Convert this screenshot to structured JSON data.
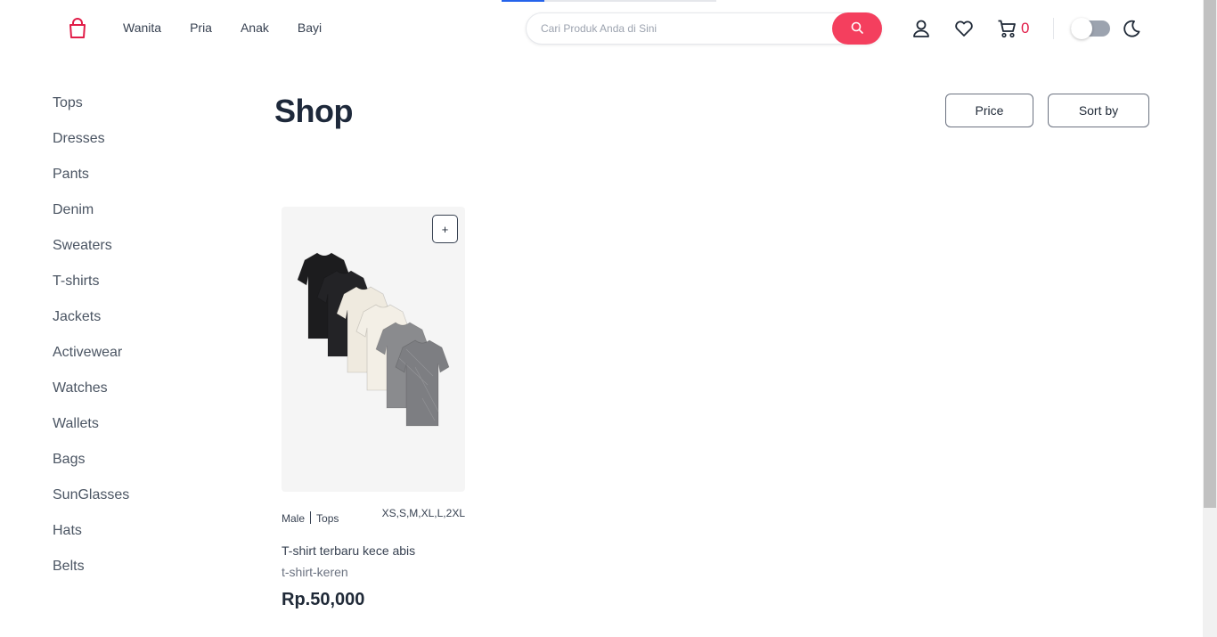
{
  "page_progress": 0.2,
  "colors": {
    "accent": "#f43f5e",
    "cart_count": "#e11d48",
    "title": "#1e293b"
  },
  "header": {
    "logo_icon": "shopping-bag-icon",
    "nav": [
      "Wanita",
      "Pria",
      "Anak",
      "Bayi"
    ],
    "search": {
      "placeholder": "Cari Produk Anda di Sini",
      "value": "",
      "icon": "search-icon"
    },
    "icons": [
      "user-icon",
      "heart-icon",
      "cart-icon"
    ],
    "cart_count": "0",
    "theme_icon": "moon-icon"
  },
  "sidebar": {
    "categories": [
      "Tops",
      "Dresses",
      "Pants",
      "Denim",
      "Sweaters",
      "T-shirts",
      "Jackets",
      "Activewear",
      "Watches",
      "Wallets",
      "Bags",
      "SunGlasses",
      "Hats",
      "Belts"
    ]
  },
  "main": {
    "title": "Shop",
    "price_button": "Price",
    "sort_button": "Sort by"
  },
  "products": [
    {
      "gender": "Male",
      "category": "Tops",
      "sizes": "XS,S,M,XL,L,2XL",
      "name": "T-shirt terbaru kece abis",
      "slug": "t-shirt-keren",
      "price": "Rp.50,000",
      "add_label": "+",
      "image": "stack of six t-shirts: two black, two cream, two heather grey"
    }
  ]
}
